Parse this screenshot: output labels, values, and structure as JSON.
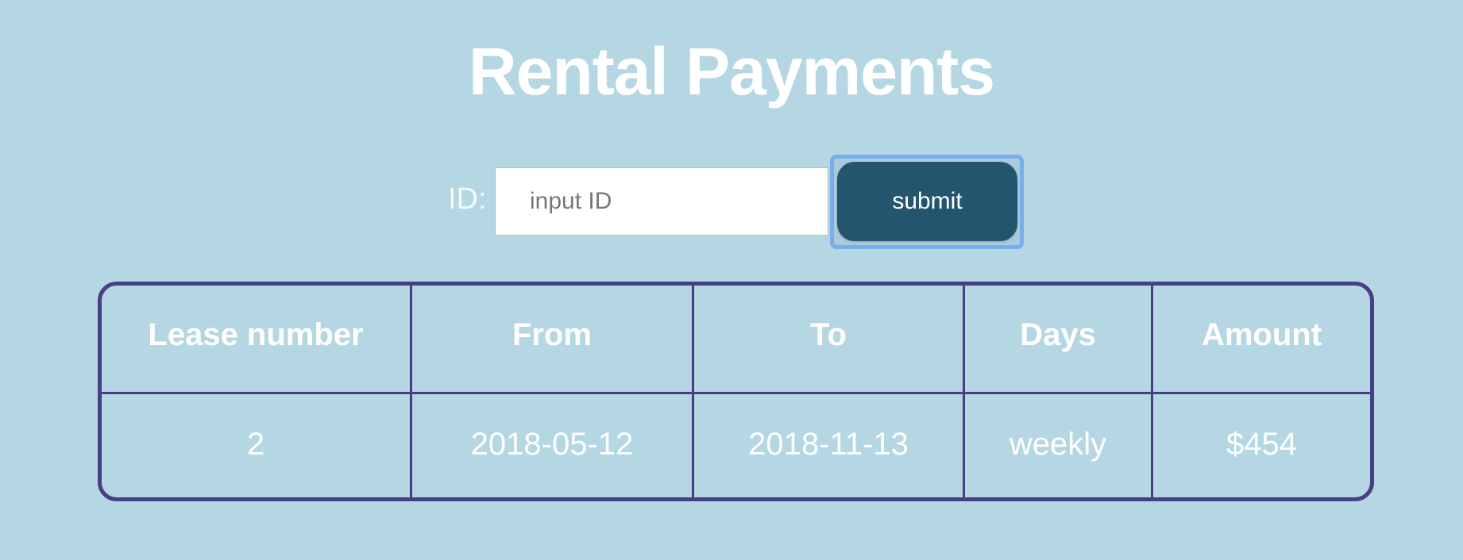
{
  "page": {
    "title": "Rental Payments"
  },
  "form": {
    "id_label": "ID:",
    "id_input_value": "",
    "id_input_placeholder": "input ID",
    "submit_label": "submit"
  },
  "table": {
    "headers": [
      "Lease number",
      "From",
      "To",
      "Days",
      "Amount"
    ],
    "rows": [
      [
        "2",
        "2018-05-12",
        "2018-11-13",
        "weekly",
        "$454"
      ]
    ]
  },
  "colors": {
    "background": "#b5d7e3",
    "button": "#23566e",
    "table_border": "#463f82",
    "focus_ring": "#7aaeea"
  }
}
